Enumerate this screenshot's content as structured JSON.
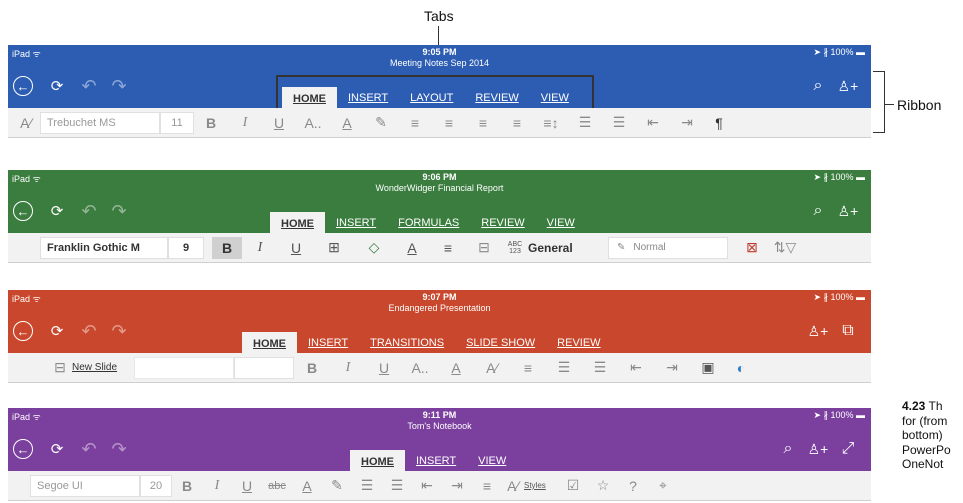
{
  "callouts": {
    "tabs": "Tabs",
    "ribbon": "Ribbon"
  },
  "caption": {
    "number": "4.23",
    "line1": "Th",
    "line2": "for (from",
    "line3": "bottom)",
    "line4": "PowerPo",
    "line5": "OneNot"
  },
  "apps": [
    {
      "color": "#2d5db3",
      "status_left": "iPad ᯤ",
      "time": "9:05 PM",
      "doc_title": "Meeting Notes Sep 2014",
      "battery": "➤ ∦ 100% ▬",
      "tabs": [
        "HOME",
        "INSERT",
        "LAYOUT",
        "REVIEW",
        "VIEW"
      ],
      "font_name": "Trebuchet MS",
      "font_size": "11"
    },
    {
      "color": "#3a7d3f",
      "status_left": "iPad ᯤ",
      "time": "9:06 PM",
      "doc_title": "WonderWidger Financial Report",
      "battery": "➤ ∦ 100% ▬",
      "tabs": [
        "HOME",
        "INSERT",
        "FORMULAS",
        "REVIEW",
        "VIEW"
      ],
      "font_name": "Franklin Gothic M",
      "font_size": "9",
      "number_format": "General",
      "abc_label": "ABC 123",
      "style_label": "Normal"
    },
    {
      "color": "#c9472c",
      "status_left": "iPad ᯤ",
      "time": "9:07 PM",
      "doc_title": "Endangered Presentation",
      "battery": "➤ ∦ 100% ▬",
      "tabs": [
        "HOME",
        "INSERT",
        "TRANSITIONS",
        "SLIDE SHOW",
        "REVIEW"
      ],
      "new_slide": "New Slide"
    },
    {
      "color": "#7b3f9e",
      "status_left": "iPad ᯤ",
      "time": "9:11 PM",
      "doc_title": "Tom's Notebook",
      "battery": "➤ ∦ 100% ▬",
      "tabs": [
        "HOME",
        "INSERT",
        "VIEW"
      ],
      "font_name": "Segoe UI",
      "font_size": "20",
      "styles_label": "Styles"
    }
  ]
}
